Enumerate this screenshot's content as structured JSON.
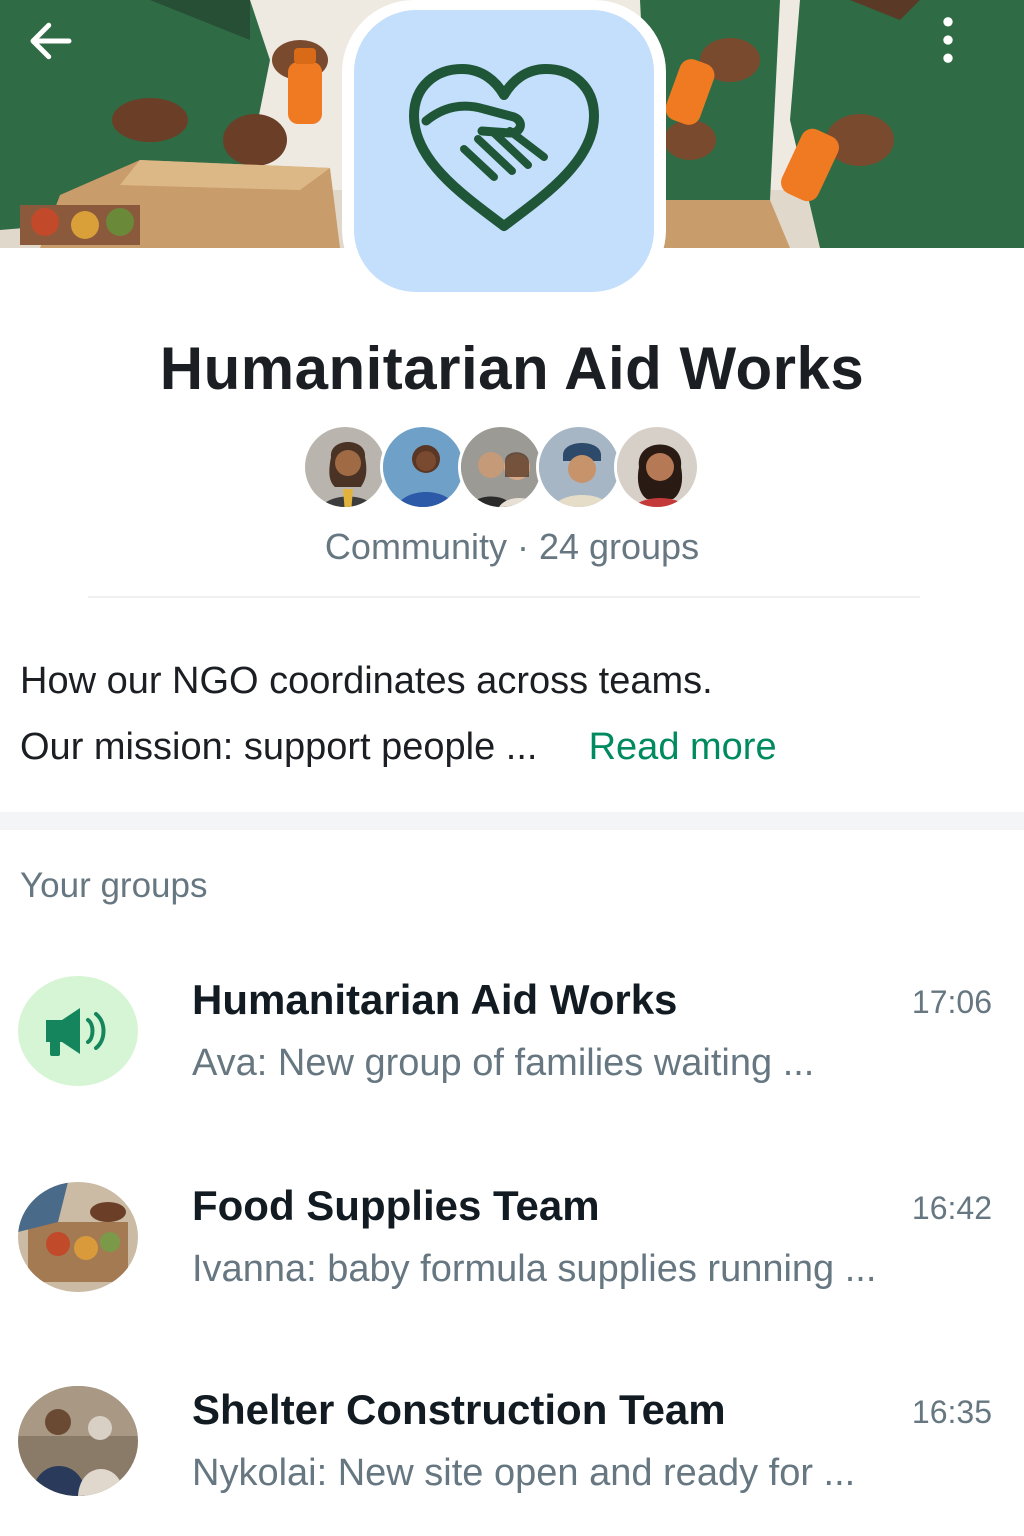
{
  "header": {
    "back_icon": "arrow-left-icon",
    "menu_icon": "more-vertical-icon"
  },
  "community": {
    "name": "Humanitarian Aid Works",
    "icon": "heart-handshake-icon",
    "icon_bg_color": "#c3dffb",
    "icon_stroke_color": "#1f5638",
    "subtitle": "Community · 24 groups",
    "description_line1": "How our NGO coordinates across teams.",
    "description_line2": "Our mission: support people ...",
    "read_more": "Read more",
    "accent_color": "#008a5f"
  },
  "groups_section": {
    "title": "Your groups",
    "groups": [
      {
        "name": "Humanitarian Aid Works",
        "time": "17:06",
        "message": "Ava: New group of families waiting ...",
        "icon": "megaphone-icon"
      },
      {
        "name": "Food Supplies Team",
        "time": "16:42",
        "message": "Ivanna: baby formula supplies running ..."
      },
      {
        "name": "Shelter Construction Team",
        "time": "16:35",
        "message": "Nykolai: New site open and ready for ..."
      }
    ]
  }
}
